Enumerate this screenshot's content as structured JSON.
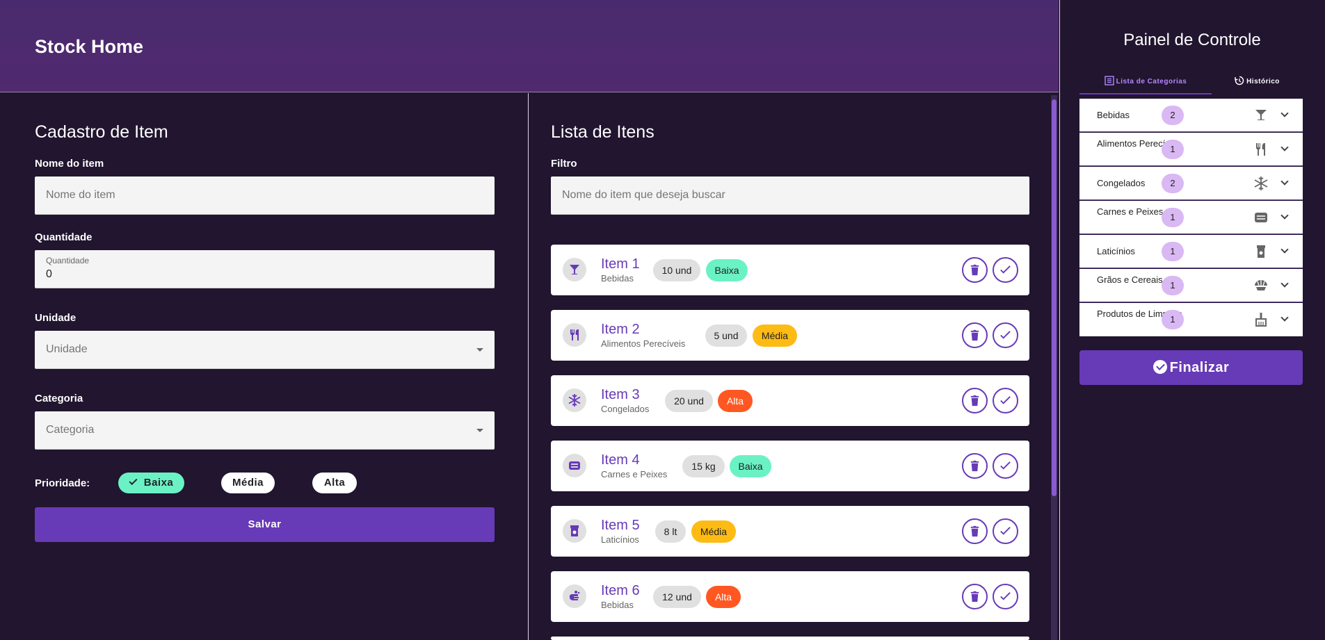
{
  "header": {
    "title": "Stock Home"
  },
  "form": {
    "title": "Cadastro de Item",
    "name_label": "Nome do item",
    "name_placeholder": "Nome do item",
    "qty_label": "Quantidade",
    "qty_float_label": "Quantidade",
    "qty_value": "0",
    "unit_label": "Unidade",
    "unit_placeholder": "Unidade",
    "category_label": "Categoria",
    "category_placeholder": "Categoria",
    "priority_label": "Prioridade:",
    "priorities": [
      "Baixa",
      "Média",
      "Alta"
    ],
    "selected_priority": "Baixa",
    "save_label": "Salvar"
  },
  "list": {
    "title": "Lista de Itens",
    "filter_label": "Filtro",
    "filter_placeholder": "Nome do item que deseja buscar",
    "items": [
      {
        "name": "Item 1",
        "category": "Bebidas",
        "qty": "10 und",
        "priority": "Baixa",
        "icon": "cocktail-icon"
      },
      {
        "name": "Item 2",
        "category": "Alimentos Perecíveis",
        "qty": "5 und",
        "priority": "Média",
        "icon": "utensils-icon"
      },
      {
        "name": "Item 3",
        "category": "Congelados",
        "qty": "20 und",
        "priority": "Alta",
        "icon": "snowflake-icon"
      },
      {
        "name": "Item 4",
        "category": "Carnes e Peixes",
        "qty": "15 kg",
        "priority": "Baixa",
        "icon": "meat-icon"
      },
      {
        "name": "Item 5",
        "category": "Laticínios",
        "qty": "8 lt",
        "priority": "Média",
        "icon": "milk-icon"
      },
      {
        "name": "Item 6",
        "category": "Bebidas",
        "qty": "12 und",
        "priority": "Alta",
        "icon": "soap-hands-icon"
      }
    ]
  },
  "panel": {
    "title": "Painel de Controle",
    "tabs": [
      "Lista de Categorias",
      "Histórico"
    ],
    "categories": [
      {
        "name": "Bebidas",
        "count": "2",
        "icon": "cocktail-icon"
      },
      {
        "name": "Alimentos Perecíveis",
        "count": "1",
        "icon": "utensils-icon"
      },
      {
        "name": "Congelados",
        "count": "2",
        "icon": "snowflake-icon"
      },
      {
        "name": "Carnes e Peixes",
        "count": "1",
        "icon": "meat-icon"
      },
      {
        "name": "Laticínios",
        "count": "1",
        "icon": "milk-icon"
      },
      {
        "name": "Grãos e Cereais",
        "count": "1",
        "icon": "grain-icon"
      },
      {
        "name": "Produtos de Limpeza",
        "count": "1",
        "icon": "broom-icon"
      }
    ],
    "finalize_label": "Finalizar"
  },
  "colors": {
    "accent": "#673ab7",
    "baixa": "#6bf2c4",
    "media": "#fdbb14",
    "alta": "#ff5722",
    "background": "#21152f"
  }
}
